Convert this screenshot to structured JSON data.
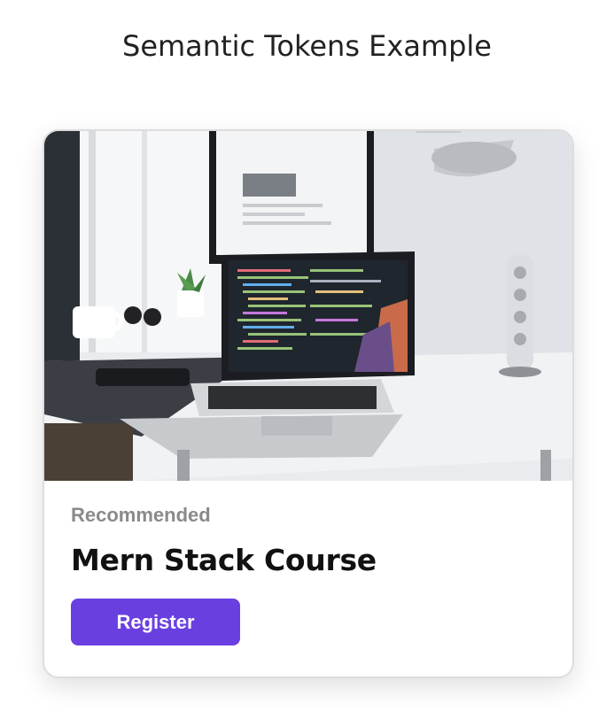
{
  "page": {
    "title": "Semantic Tokens Example"
  },
  "card": {
    "image_subject": "laptop-on-desk-with-code-editor",
    "eyebrow": "Recommended",
    "title": "Mern Stack Course",
    "button_label": "Register"
  },
  "colors": {
    "accent": "#6a3fe0",
    "eyebrow": "#8a8a8a",
    "title": "#111111",
    "card_border": "#dddddd"
  }
}
